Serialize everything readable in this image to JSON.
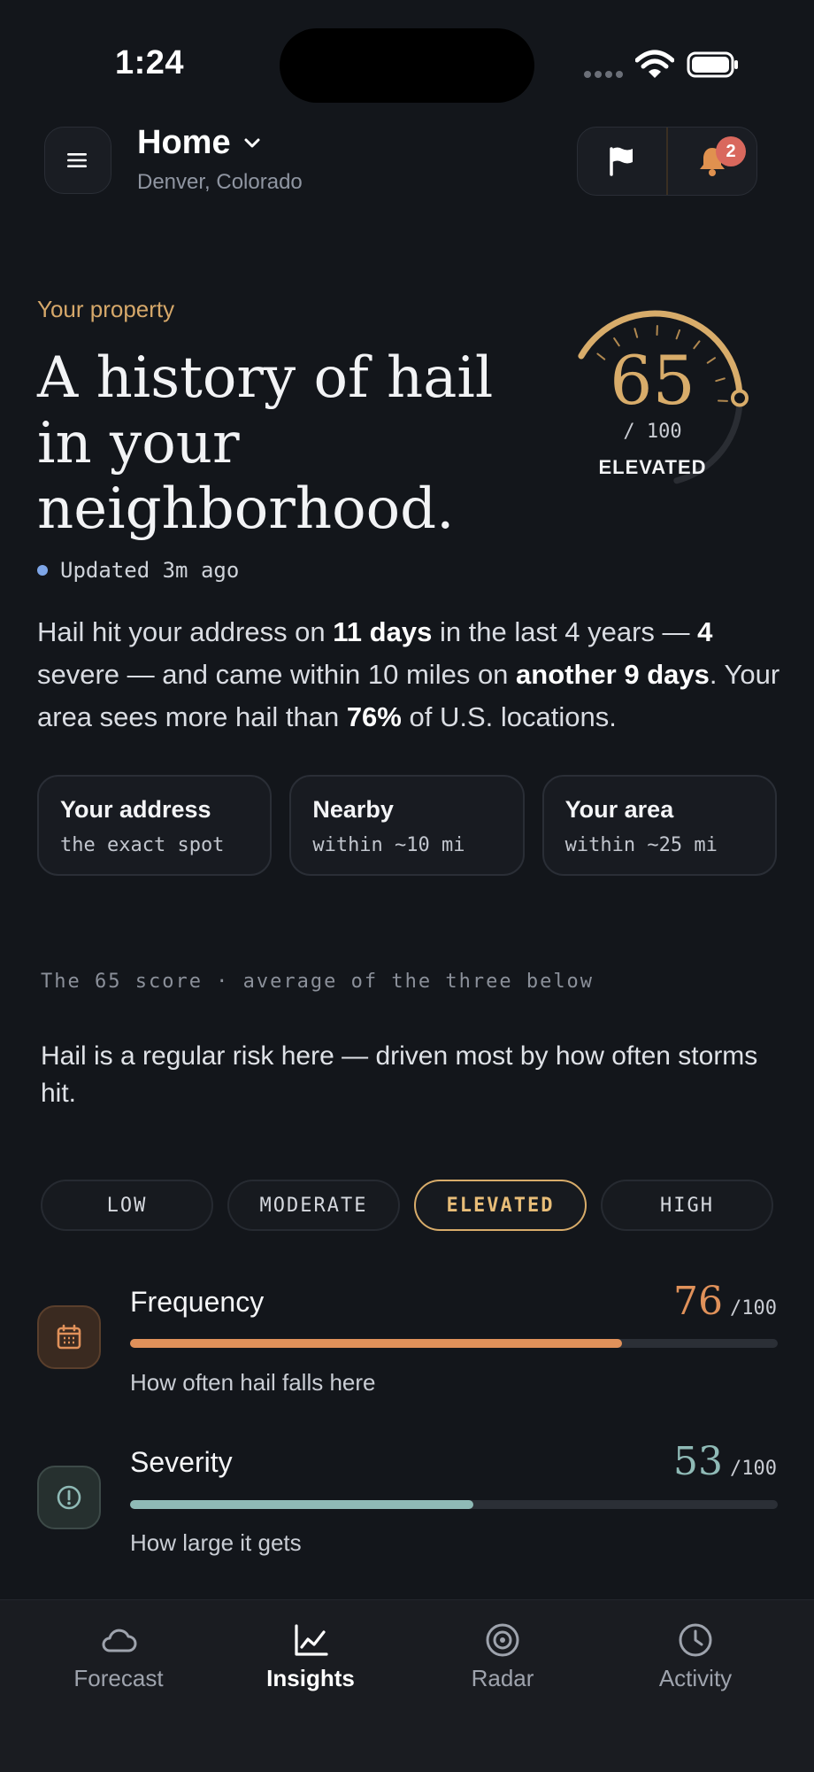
{
  "status_bar": {
    "time": "1:24"
  },
  "header": {
    "title": "Home",
    "subtitle": "Denver, Colorado",
    "notification_count": "2"
  },
  "property": {
    "eyebrow": "Your property",
    "headline": "A history of hail in your neighborhood.",
    "updated": "Updated 3m ago",
    "score": "65",
    "score_max": "/ 100",
    "score_fraction": 0.65,
    "level": "ELEVATED"
  },
  "summary": {
    "p1": "Hail hit your address on ",
    "b1": "11 days",
    "p2": " in the last 4 years — ",
    "b2": "4",
    "p3": " severe — and came within 10 miles on ",
    "b3": "another 9 days",
    "p4": ". Your area sees more hail than ",
    "b4": "76%",
    "p5": " of U.S. locations."
  },
  "scopes": [
    {
      "title": "Your address",
      "sub": "the exact spot"
    },
    {
      "title": "Nearby",
      "sub": "within ~10 mi"
    },
    {
      "title": "Your area",
      "sub": "within ~25 mi"
    }
  ],
  "score_note": "The 65 score · average of the three below",
  "score_desc": "Hail is a regular risk here — driven most by how often storms hit.",
  "levels": [
    "LOW",
    "MODERATE",
    "ELEVATED",
    "HIGH"
  ],
  "active_level": "ELEVATED",
  "metrics": [
    {
      "title": "Frequency",
      "value": "76",
      "max": "/100",
      "fraction": 0.76,
      "sub": "How often hail falls here",
      "color": "#e0915a"
    },
    {
      "title": "Severity",
      "value": "53",
      "max": "/100",
      "fraction": 0.53,
      "sub": "How large it gets",
      "color": "#8fbab6"
    }
  ],
  "tabs": [
    "Forecast",
    "Insights",
    "Radar",
    "Activity"
  ],
  "active_tab": "Insights",
  "colors": {
    "accent": "#d8ac6a",
    "background": "#13161b"
  }
}
